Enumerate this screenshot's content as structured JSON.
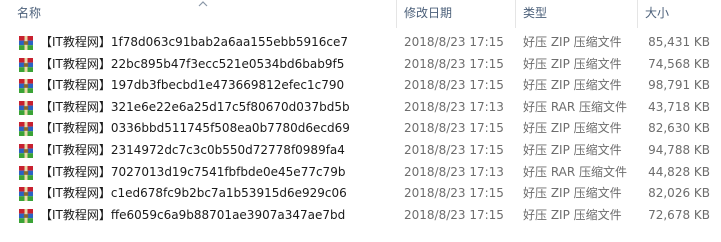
{
  "columns": {
    "name": "名称",
    "date": "修改日期",
    "type": "类型",
    "size": "大小"
  },
  "files": [
    {
      "name": "【IT教程网】1f78d063c91bab2a6aa155ebb5916ce7",
      "date": "2018/8/23 17:15",
      "type": "好压 ZIP 压缩文件",
      "size": "85,431 KB"
    },
    {
      "name": "【IT教程网】22bc895b47f3ecc521e0534bd6bab9f5",
      "date": "2018/8/23 17:15",
      "type": "好压 ZIP 压缩文件",
      "size": "74,568 KB"
    },
    {
      "name": "【IT教程网】197db3fbecbd1e473669812efec1c790",
      "date": "2018/8/23 17:15",
      "type": "好压 ZIP 压缩文件",
      "size": "98,791 KB"
    },
    {
      "name": "【IT教程网】321e6e22e6a25d17c5f80670d037bd5b",
      "date": "2018/8/23 17:13",
      "type": "好压 RAR 压缩文件",
      "size": "43,718 KB"
    },
    {
      "name": "【IT教程网】0336bbd511745f508ea0b7780d6ecd69",
      "date": "2018/8/23 17:15",
      "type": "好压 ZIP 压缩文件",
      "size": "82,630 KB"
    },
    {
      "name": "【IT教程网】2314972dc7c3c0b550d72778f0989fa4",
      "date": "2018/8/23 17:15",
      "type": "好压 ZIP 压缩文件",
      "size": "94,788 KB"
    },
    {
      "name": "【IT教程网】7027013d19c7541fbfbde0e45e77c79b",
      "date": "2018/8/23 17:13",
      "type": "好压 RAR 压缩文件",
      "size": "44,828 KB"
    },
    {
      "name": "【IT教程网】c1ed678fc9b2bc7a1b53915d6e929c06",
      "date": "2018/8/23 17:15",
      "type": "好压 ZIP 压缩文件",
      "size": "82,026 KB"
    },
    {
      "name": "【IT教程网】ffe6059c6a9b88701ae3907a347ae7bd",
      "date": "2018/8/23 17:15",
      "type": "好压 ZIP 压缩文件",
      "size": "72,678 KB"
    }
  ],
  "icons": {
    "file": "archive-file-icon",
    "sort": "sort-ascending-icon"
  },
  "colors": {
    "header_text": "#4c607a",
    "secondary_text": "#6d6d6d",
    "archive_red": "#c8202f",
    "archive_blue": "#2b62c4",
    "archive_green": "#3aa336"
  }
}
